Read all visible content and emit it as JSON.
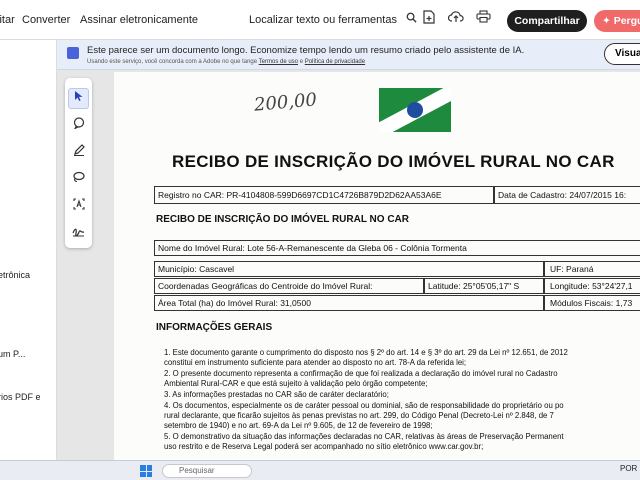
{
  "toolbar": {
    "menu_items": [
      "Editar",
      "Converter",
      "Assinar eletronicamente"
    ],
    "search_label": "Localizar texto ou ferramentas",
    "share_label": "Compartilhar",
    "ask_label": "Pergunt"
  },
  "left_panel": {
    "items": [
      "etrônica",
      "um P...",
      "rios PDF e"
    ]
  },
  "banner": {
    "text": "Este parece ser um documento longo. Economize tempo lendo um resumo criado pelo assistente de IA.",
    "small_prefix": "Usando este serviço, você concorda com a Adobe no que tange",
    "terms_link": "Termos de uso",
    "and_text": "e",
    "privacy_link": "Política de privacidade",
    "view_label": "Visual"
  },
  "tools": [
    "select-arrow-icon",
    "comment-icon",
    "pen-icon",
    "lasso-icon",
    "text-recognize-icon",
    "sign-icon"
  ],
  "document": {
    "handwritten": "200,00",
    "title": "RECIBO DE INSCRIÇÃO DO IMÓVEL RURAL NO CAR",
    "registro": "Registro no CAR: PR-4104808-599D6697CD1C4726B879D2D62AA53A6E",
    "data_cadastro": "Data de Cadastro: 24/07/2015 16:",
    "subtitle": "RECIBO DE INSCRIÇÃO DO IMÓVEL RURAL NO CAR",
    "nome_imovel": "Nome do Imóvel Rural: Lote 56-A-Remanescente da Gleba 06 - Colônia Tormenta",
    "municipio": "Município: Cascavel",
    "uf": "UF: Paraná",
    "coordenadas": "Coordenadas Geográficas do Centroide do Imóvel Rural:",
    "latitude": "Latitude: 25°05'05,17\" S",
    "longitude": "Longitude: 53°24'27,1",
    "area": "Área Total (ha) do Imóvel Rural: 31,0500",
    "modulos": "Módulos Fiscais: 1,73",
    "info_title": "INFORMAÇÕES GERAIS",
    "items": [
      "1.  Este documento garante o cumprimento do disposto nos § 2º do art. 14 e § 3º do art. 29 da Lei nº 12.651, de 2012",
      "     constitui em instrumento suficiente para atender ao disposto no art. 78-A da referida lei;",
      "2.  O presente documento representa a confirmação de que foi realizada a declaração do imóvel rural no Cadastro",
      "     Ambiental Rural-CAR e que está sujeito à validação pelo órgão competente;",
      "3.  As informações prestadas no CAR são de caráter declaratório;",
      "4.  Os documentos, especialmente os de caráter pessoal ou dominial, são de responsabilidade do proprietário ou po",
      "     rural declarante, que ficarão sujeitos às penas previstas no art. 299, do Código Penal (Decreto-Lei nº 2.848, de 7",
      "     setembro de 1940) e no art. 69-A da Lei nº 9.605, de 12 de fevereiro de 1998;",
      "5.  O demonstrativo da situação das informações declaradas no CAR, relativas às áreas de Preservação Permanent",
      "     uso restrito e de Reserva Legal poderá ser acompanhado no sítio eletrônico www.car.gov.br;"
    ]
  },
  "taskbar": {
    "search_placeholder": "Pesquisar",
    "tray_text": "POR"
  }
}
